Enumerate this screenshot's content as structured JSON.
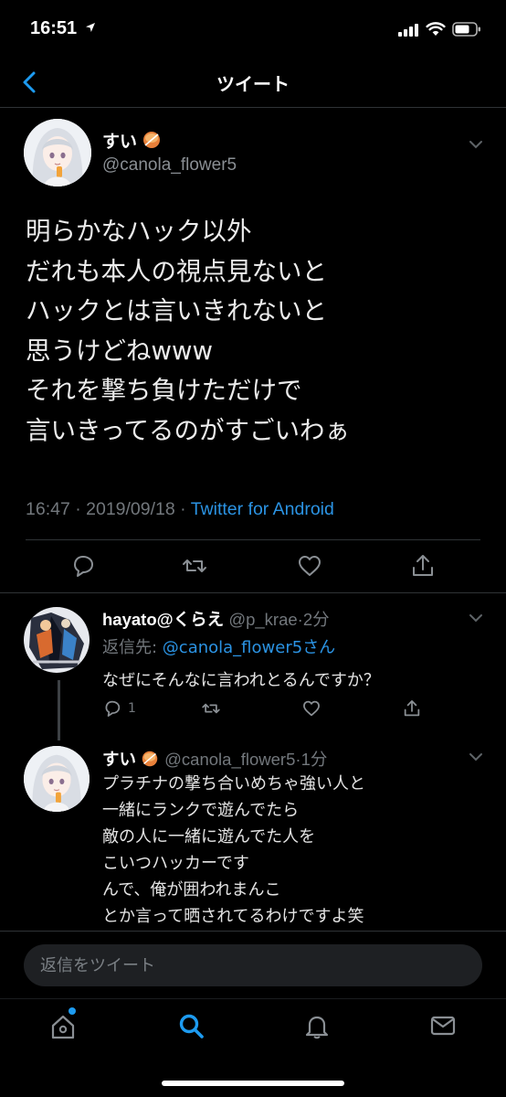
{
  "status_bar": {
    "time": "16:51"
  },
  "nav": {
    "title": "ツイート"
  },
  "main_tweet": {
    "name": "すい",
    "handle": "@canola_flower5",
    "text": "明らかなハック以外\nだれも本人の視点見ないと\nハックとは言いきれないと\n思うけどねwww\nそれを撃ち負けただけで\n言いきってるのがすごいわぁ",
    "time": "16:47 · 2019/09/18 · ",
    "source": "Twitter for Android"
  },
  "reply1": {
    "name": "hayato@くらえ",
    "handle": "@p_krae",
    "time": "2分",
    "replying_prefix": "返信先: ",
    "replying_mention": "@canola_flower5さん",
    "text": "なぜにそんなに言われとるんですか？",
    "reply_count": "1"
  },
  "reply2": {
    "name": "すい",
    "handle": "@canola_flower5",
    "time": "1分",
    "text": "プラチナの撃ち合いめちゃ強い人と\n一緒にランクで遊んでたら\n敵の人に一緒に遊んでた人を\nこいつハッカーです\nんで、俺が囲われまんこ\nとか言って晒されてるわけですよ笑"
  },
  "reply_bar": {
    "placeholder": "返信をツイート"
  },
  "colors": {
    "accent": "#1d9bf0",
    "link": "#2b93e3",
    "muted": "#72777c",
    "background": "#000000"
  },
  "icons": [
    "back-icon",
    "chevron-down-icon",
    "comment-icon",
    "retweet-icon",
    "like-icon",
    "share-icon",
    "home-icon",
    "search-icon",
    "notifications-icon",
    "messages-icon"
  ]
}
